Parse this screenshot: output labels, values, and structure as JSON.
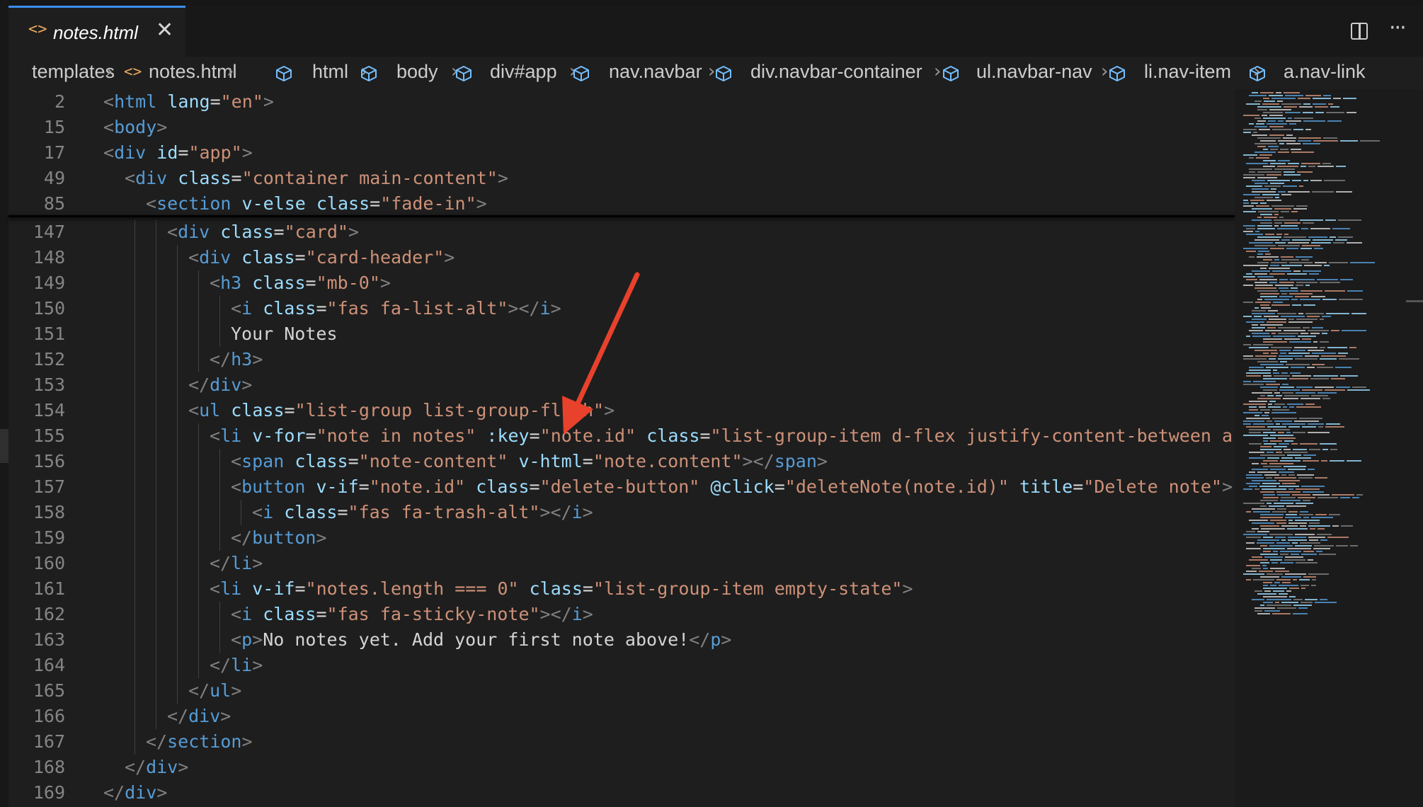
{
  "tab": {
    "icon": "code-file-icon",
    "filename": "notes.html",
    "close": "✕"
  },
  "toolbar": {
    "split_editor_icon": "split-editor-icon",
    "more_actions": "···"
  },
  "breadcrumb": [
    {
      "label": "templates",
      "icon": ""
    },
    {
      "label": "notes.html",
      "icon": "code-file-icon"
    },
    {
      "label": "html",
      "icon": "symbol-element-icon"
    },
    {
      "label": "body",
      "icon": "symbol-element-icon"
    },
    {
      "label": "div#app",
      "icon": "symbol-element-icon"
    },
    {
      "label": "nav.navbar",
      "icon": "symbol-element-icon"
    },
    {
      "label": "div.navbar-container",
      "icon": "symbol-element-icon"
    },
    {
      "label": "ul.navbar-nav",
      "icon": "symbol-element-icon"
    },
    {
      "label": "li.nav-item",
      "icon": "symbol-element-icon"
    },
    {
      "label": "a.nav-link",
      "icon": "symbol-element-icon"
    }
  ],
  "sticky_lines": [
    {
      "n": "2",
      "indent": 0,
      "tokens": [
        [
          "b",
          "<"
        ],
        [
          "t",
          "html"
        ],
        [
          "p",
          " "
        ],
        [
          "a",
          "lang"
        ],
        [
          "p",
          "="
        ],
        [
          "s",
          "\"en\""
        ],
        [
          "b",
          ">"
        ]
      ]
    },
    {
      "n": "15",
      "indent": 0,
      "tokens": [
        [
          "b",
          "<"
        ],
        [
          "t",
          "body"
        ],
        [
          "b",
          ">"
        ]
      ]
    },
    {
      "n": "17",
      "indent": 0,
      "tokens": [
        [
          "b",
          "<"
        ],
        [
          "t",
          "div"
        ],
        [
          "p",
          " "
        ],
        [
          "a",
          "id"
        ],
        [
          "p",
          "="
        ],
        [
          "s",
          "\"app\""
        ],
        [
          "b",
          ">"
        ]
      ]
    },
    {
      "n": "49",
      "indent": 1,
      "tokens": [
        [
          "b",
          "<"
        ],
        [
          "t",
          "div"
        ],
        [
          "p",
          " "
        ],
        [
          "a",
          "class"
        ],
        [
          "p",
          "="
        ],
        [
          "s",
          "\"container main-content\""
        ],
        [
          "b",
          ">"
        ]
      ]
    },
    {
      "n": "85",
      "indent": 2,
      "tokens": [
        [
          "b",
          "<"
        ],
        [
          "t",
          "section"
        ],
        [
          "p",
          " "
        ],
        [
          "a",
          "v-else"
        ],
        [
          "p",
          " "
        ],
        [
          "a",
          "class"
        ],
        [
          "p",
          "="
        ],
        [
          "s",
          "\"fade-in\""
        ],
        [
          "b",
          ">"
        ]
      ]
    }
  ],
  "code_lines": [
    {
      "n": "147",
      "indent": 3,
      "tokens": [
        [
          "b",
          "<"
        ],
        [
          "t",
          "div"
        ],
        [
          "p",
          " "
        ],
        [
          "a",
          "class"
        ],
        [
          "p",
          "="
        ],
        [
          "s",
          "\"card\""
        ],
        [
          "b",
          ">"
        ]
      ]
    },
    {
      "n": "148",
      "indent": 4,
      "tokens": [
        [
          "b",
          "<"
        ],
        [
          "t",
          "div"
        ],
        [
          "p",
          " "
        ],
        [
          "a",
          "class"
        ],
        [
          "p",
          "="
        ],
        [
          "s",
          "\"card-header\""
        ],
        [
          "b",
          ">"
        ]
      ]
    },
    {
      "n": "149",
      "indent": 5,
      "tokens": [
        [
          "b",
          "<"
        ],
        [
          "t",
          "h3"
        ],
        [
          "p",
          " "
        ],
        [
          "a",
          "class"
        ],
        [
          "p",
          "="
        ],
        [
          "s",
          "\"mb-0\""
        ],
        [
          "b",
          ">"
        ]
      ]
    },
    {
      "n": "150",
      "indent": 6,
      "tokens": [
        [
          "b",
          "<"
        ],
        [
          "t",
          "i"
        ],
        [
          "p",
          " "
        ],
        [
          "a",
          "class"
        ],
        [
          "p",
          "="
        ],
        [
          "s",
          "\"fas fa-list-alt\""
        ],
        [
          "b",
          "></"
        ],
        [
          "t",
          "i"
        ],
        [
          "b",
          ">"
        ]
      ]
    },
    {
      "n": "151",
      "indent": 6,
      "tokens": [
        [
          "p",
          "Your Notes"
        ]
      ]
    },
    {
      "n": "152",
      "indent": 5,
      "tokens": [
        [
          "b",
          "</"
        ],
        [
          "t",
          "h3"
        ],
        [
          "b",
          ">"
        ]
      ]
    },
    {
      "n": "153",
      "indent": 4,
      "tokens": [
        [
          "b",
          "</"
        ],
        [
          "t",
          "div"
        ],
        [
          "b",
          ">"
        ]
      ]
    },
    {
      "n": "154",
      "indent": 4,
      "tokens": [
        [
          "b",
          "<"
        ],
        [
          "t",
          "ul"
        ],
        [
          "p",
          " "
        ],
        [
          "a",
          "class"
        ],
        [
          "p",
          "="
        ],
        [
          "s",
          "\"list-group list-group-flush\""
        ],
        [
          "b",
          ">"
        ]
      ]
    },
    {
      "n": "155",
      "indent": 5,
      "tokens": [
        [
          "b",
          "<"
        ],
        [
          "t",
          "li"
        ],
        [
          "p",
          " "
        ],
        [
          "a",
          "v-for"
        ],
        [
          "p",
          "="
        ],
        [
          "s",
          "\"note in notes\""
        ],
        [
          "p",
          " "
        ],
        [
          "a",
          ":key"
        ],
        [
          "p",
          "="
        ],
        [
          "s",
          "\"note.id\""
        ],
        [
          "p",
          " "
        ],
        [
          "a",
          "class"
        ],
        [
          "p",
          "="
        ],
        [
          "s",
          "\"list-group-item d-flex justify-content-between align-items-center\""
        ],
        [
          "b",
          ">"
        ]
      ]
    },
    {
      "n": "156",
      "indent": 6,
      "tokens": [
        [
          "b",
          "<"
        ],
        [
          "t",
          "span"
        ],
        [
          "p",
          " "
        ],
        [
          "a",
          "class"
        ],
        [
          "p",
          "="
        ],
        [
          "s",
          "\"note-content\""
        ],
        [
          "p",
          " "
        ],
        [
          "a",
          "v-html"
        ],
        [
          "p",
          "="
        ],
        [
          "s",
          "\"note.content\""
        ],
        [
          "b",
          "></"
        ],
        [
          "t",
          "span"
        ],
        [
          "b",
          ">"
        ]
      ]
    },
    {
      "n": "157",
      "indent": 6,
      "tokens": [
        [
          "b",
          "<"
        ],
        [
          "t",
          "button"
        ],
        [
          "p",
          " "
        ],
        [
          "a",
          "v-if"
        ],
        [
          "p",
          "="
        ],
        [
          "s",
          "\"note.id\""
        ],
        [
          "p",
          " "
        ],
        [
          "a",
          "class"
        ],
        [
          "p",
          "="
        ],
        [
          "s",
          "\"delete-button\""
        ],
        [
          "p",
          " "
        ],
        [
          "a",
          "@click"
        ],
        [
          "p",
          "="
        ],
        [
          "s",
          "\"deleteNote(note.id)\""
        ],
        [
          "p",
          " "
        ],
        [
          "a",
          "title"
        ],
        [
          "p",
          "="
        ],
        [
          "s",
          "\"Delete note\""
        ],
        [
          "b",
          ">"
        ]
      ]
    },
    {
      "n": "158",
      "indent": 7,
      "tokens": [
        [
          "b",
          "<"
        ],
        [
          "t",
          "i"
        ],
        [
          "p",
          " "
        ],
        [
          "a",
          "class"
        ],
        [
          "p",
          "="
        ],
        [
          "s",
          "\"fas fa-trash-alt\""
        ],
        [
          "b",
          "></"
        ],
        [
          "t",
          "i"
        ],
        [
          "b",
          ">"
        ]
      ]
    },
    {
      "n": "159",
      "indent": 6,
      "tokens": [
        [
          "b",
          "</"
        ],
        [
          "t",
          "button"
        ],
        [
          "b",
          ">"
        ]
      ]
    },
    {
      "n": "160",
      "indent": 5,
      "tokens": [
        [
          "b",
          "</"
        ],
        [
          "t",
          "li"
        ],
        [
          "b",
          ">"
        ]
      ]
    },
    {
      "n": "161",
      "indent": 5,
      "tokens": [
        [
          "b",
          "<"
        ],
        [
          "t",
          "li"
        ],
        [
          "p",
          " "
        ],
        [
          "a",
          "v-if"
        ],
        [
          "p",
          "="
        ],
        [
          "s",
          "\"notes.length === 0\""
        ],
        [
          "p",
          " "
        ],
        [
          "a",
          "class"
        ],
        [
          "p",
          "="
        ],
        [
          "s",
          "\"list-group-item empty-state\""
        ],
        [
          "b",
          ">"
        ]
      ]
    },
    {
      "n": "162",
      "indent": 6,
      "tokens": [
        [
          "b",
          "<"
        ],
        [
          "t",
          "i"
        ],
        [
          "p",
          " "
        ],
        [
          "a",
          "class"
        ],
        [
          "p",
          "="
        ],
        [
          "s",
          "\"fas fa-sticky-note\""
        ],
        [
          "b",
          "></"
        ],
        [
          "t",
          "i"
        ],
        [
          "b",
          ">"
        ]
      ]
    },
    {
      "n": "163",
      "indent": 6,
      "tokens": [
        [
          "b",
          "<"
        ],
        [
          "t",
          "p"
        ],
        [
          "b",
          ">"
        ],
        [
          "p",
          "No notes yet. Add your first note above!"
        ],
        [
          "b",
          "</"
        ],
        [
          "t",
          "p"
        ],
        [
          "b",
          ">"
        ]
      ]
    },
    {
      "n": "164",
      "indent": 5,
      "tokens": [
        [
          "b",
          "</"
        ],
        [
          "t",
          "li"
        ],
        [
          "b",
          ">"
        ]
      ]
    },
    {
      "n": "165",
      "indent": 4,
      "tokens": [
        [
          "b",
          "</"
        ],
        [
          "t",
          "ul"
        ],
        [
          "b",
          ">"
        ]
      ]
    },
    {
      "n": "166",
      "indent": 3,
      "tokens": [
        [
          "b",
          "</"
        ],
        [
          "t",
          "div"
        ],
        [
          "b",
          ">"
        ]
      ]
    },
    {
      "n": "167",
      "indent": 2,
      "tokens": [
        [
          "b",
          "</"
        ],
        [
          "t",
          "section"
        ],
        [
          "b",
          ">"
        ]
      ]
    },
    {
      "n": "168",
      "indent": 1,
      "tokens": [
        [
          "b",
          "</"
        ],
        [
          "t",
          "div"
        ],
        [
          "b",
          ">"
        ]
      ]
    },
    {
      "n": "169",
      "indent": 0,
      "tokens": [
        [
          "b",
          "</"
        ],
        [
          "t",
          "div"
        ],
        [
          "b",
          ">"
        ]
      ]
    }
  ],
  "annotation": {
    "icon": "red-arrow-annotation",
    "color": "#e8412c"
  },
  "colors": {
    "tag": "#569cd6",
    "bracket": "#808080",
    "attribute": "#9cdcfe",
    "string": "#ce9178",
    "text": "#d4d4d4",
    "line_number": "#858585",
    "background": "#1e1e1e",
    "tab_border": "#3b8eea"
  }
}
